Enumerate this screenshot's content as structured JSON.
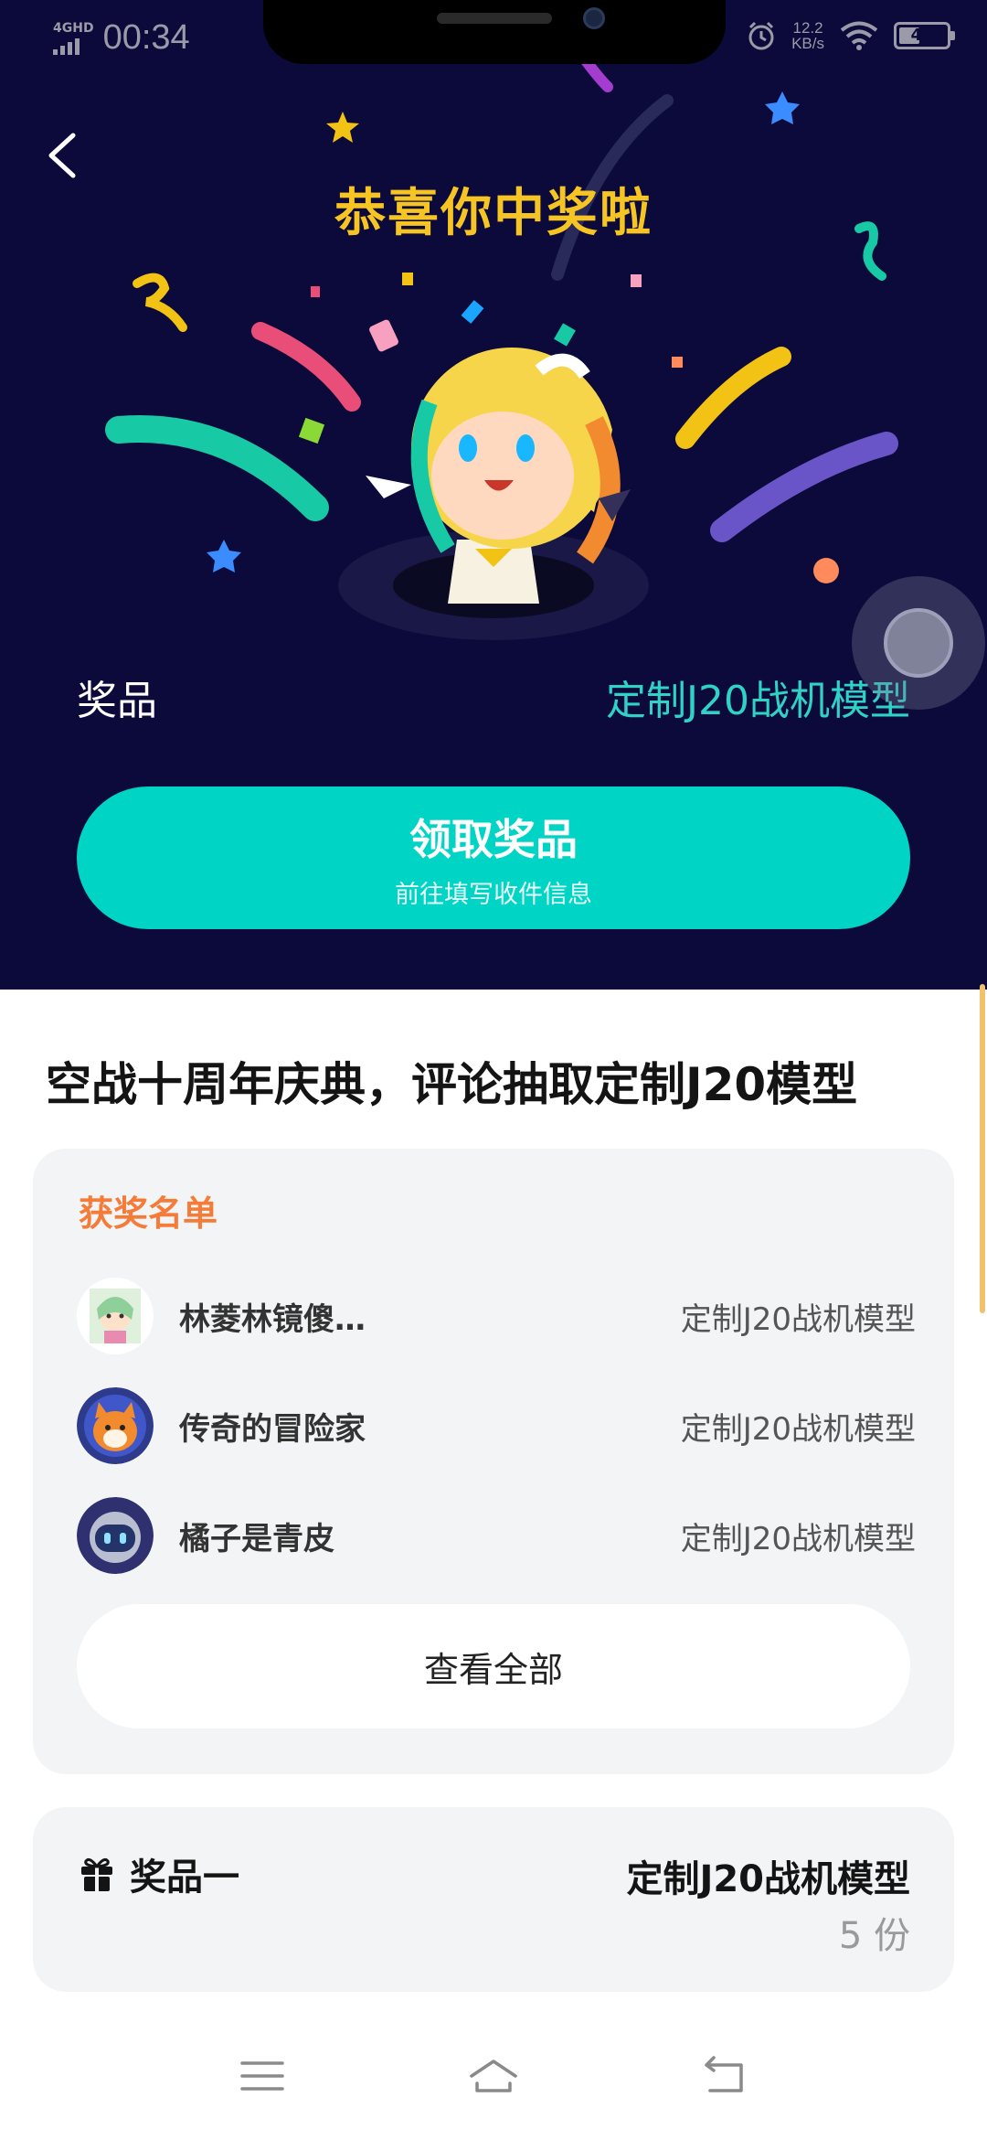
{
  "status_bar": {
    "network": "4GHD",
    "time": "00:34",
    "speed_value": "12.2",
    "speed_unit": "KB/s",
    "battery": "41"
  },
  "hero": {
    "title": "恭喜你中奖啦",
    "prize_label": "奖品",
    "prize_value": "定制J20战机模型",
    "claim_button": {
      "main": "领取奖品",
      "sub": "前往填写收件信息"
    }
  },
  "event": {
    "title": "空战十周年庆典，评论抽取定制J20模型"
  },
  "winners": {
    "title": "获奖名单",
    "rows": [
      {
        "name": "林菱林镜傻…",
        "prize": "定制J20战机模型"
      },
      {
        "name": "传奇的冒险家",
        "prize": "定制J20战机模型"
      },
      {
        "name": "橘子是青皮",
        "prize": "定制J20战机模型"
      }
    ],
    "view_all": "查看全部"
  },
  "prize_card": {
    "label": "奖品一",
    "value": "定制J20战机模型",
    "count": "5 份"
  },
  "colors": {
    "hero_bg": "#0b0a3a",
    "title_gold": "#f6c524",
    "accent_teal": "#00d4c4",
    "prize_teal": "#2ed3c6",
    "winners_orange": "#f47b38"
  },
  "icons": [
    "back-icon",
    "gift-icon",
    "menu-icon",
    "home-icon",
    "return-icon",
    "alarm-icon",
    "wifi-icon",
    "battery-icon"
  ]
}
